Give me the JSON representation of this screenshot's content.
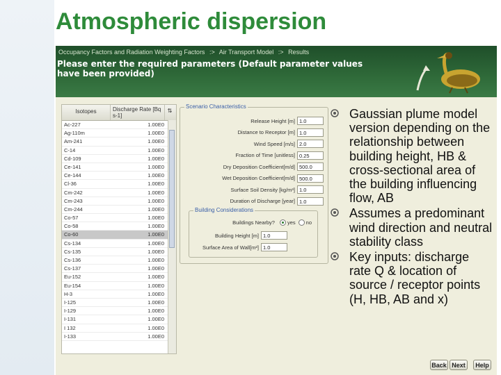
{
  "slide": {
    "title": "Atmospheric dispersion"
  },
  "app": {
    "breadcrumb": [
      "Occupancy Factors and Radiation Weighting Factors",
      ":>",
      "Air Transport Model",
      ":>",
      "Results"
    ],
    "instruction": "Please enter the required parameters (Default parameter values have been provided)"
  },
  "isotope_table": {
    "columns": [
      "Isotopes",
      "Discharge Rate [Bq s-1]"
    ],
    "sort_icon": "sort-icon",
    "rows": [
      {
        "isotope": "Ac-227",
        "rate": "1.00E0"
      },
      {
        "isotope": "Ag-110m",
        "rate": "1.00E0"
      },
      {
        "isotope": "Am-241",
        "rate": "1.00E0"
      },
      {
        "isotope": "C-14",
        "rate": "1.00E0"
      },
      {
        "isotope": "Cd-109",
        "rate": "1.00E0"
      },
      {
        "isotope": "Ce-141",
        "rate": "1.00E0"
      },
      {
        "isotope": "Ce-144",
        "rate": "1.00E0"
      },
      {
        "isotope": "Cl-36",
        "rate": "1.00E0"
      },
      {
        "isotope": "Cm-242",
        "rate": "1.00E0"
      },
      {
        "isotope": "Cm-243",
        "rate": "1.00E0"
      },
      {
        "isotope": "Cm-244",
        "rate": "1.00E0"
      },
      {
        "isotope": "Co-57",
        "rate": "1.00E0"
      },
      {
        "isotope": "Co-58",
        "rate": "1.00E0"
      },
      {
        "isotope": "Co-60",
        "rate": "1.00E0",
        "selected": true
      },
      {
        "isotope": "Cs-134",
        "rate": "1.00E0"
      },
      {
        "isotope": "Cs-135",
        "rate": "1.00E0"
      },
      {
        "isotope": "Cs-136",
        "rate": "1.00E0"
      },
      {
        "isotope": "Cs-137",
        "rate": "1.00E0"
      },
      {
        "isotope": "Eu-152",
        "rate": "1.00E0"
      },
      {
        "isotope": "Eu-154",
        "rate": "1.00E0"
      },
      {
        "isotope": "H-3",
        "rate": "1.00E0"
      },
      {
        "isotope": "I-125",
        "rate": "1.00E0"
      },
      {
        "isotope": "I-129",
        "rate": "1.00E0"
      },
      {
        "isotope": "I-131",
        "rate": "1.00E0"
      },
      {
        "isotope": "I 132",
        "rate": "1.00E0"
      },
      {
        "isotope": "I-133",
        "rate": "1.00E0"
      }
    ]
  },
  "scenario": {
    "legend": "Scenario Characteristics",
    "params": [
      {
        "label": "Release Height [m]",
        "value": "1.0"
      },
      {
        "label": "Distance to Receptor [m]",
        "value": "1.0"
      },
      {
        "label": "Wind Speed [m/s]",
        "value": "2.0"
      },
      {
        "label": "Fraction of Time [unitless]",
        "value": "0.25"
      },
      {
        "label": "Dry Deposition Coefficient[m/d]",
        "value": "500.0"
      },
      {
        "label": "Wet Deposition Coefficient[m/d]",
        "value": "500.0"
      },
      {
        "label": "Surface Soil Density [kg/m³]",
        "value": "1.0"
      },
      {
        "label": "Duration of Discharge [year]",
        "value": "1.0"
      }
    ],
    "building": {
      "legend": "Building Considerations",
      "nearby_label": "Buildings Nearby?",
      "yes_label": "yes",
      "no_label": "no",
      "height_label": "Building Height [m]",
      "height_value": "1.0",
      "area_label": "Surface Area of Wall[m²]",
      "area_value": "1.0"
    }
  },
  "bullets": [
    "Gaussian plume model version depending on the relationship between building height, HB & cross-sectional area of the building influencing flow, AB",
    "Assumes a predominant wind direction and neutral stability class",
    "Key inputs: discharge rate Q & location of source / receptor points (H, HB, AB and x)"
  ],
  "nav": {
    "back": "Back",
    "next": "Next",
    "help": "Help"
  },
  "colors": {
    "title": "#2e8b3a",
    "header_bg": "#2f6a39",
    "panel_bg": "#efeedd",
    "legend_text": "#3a5fa8"
  }
}
